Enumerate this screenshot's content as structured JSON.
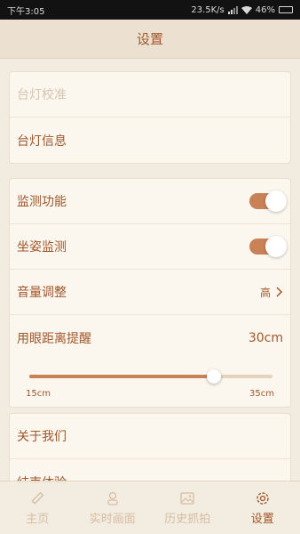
{
  "status_bar": {
    "time": "下午3:05",
    "network_speed": "23.5K/s",
    "battery": "46%"
  },
  "header": {
    "title": "设置"
  },
  "group1": {
    "items": [
      {
        "label": "台灯校准",
        "disabled": true
      },
      {
        "label": "台灯信息",
        "disabled": false
      }
    ]
  },
  "group2": {
    "monitor": {
      "label": "监测功能",
      "enabled": true
    },
    "posture": {
      "label": "坐姿监测",
      "enabled": true
    },
    "volume": {
      "label": "音量调整",
      "value": "高"
    },
    "distance": {
      "label": "用眼距离提醒",
      "value": "30cm",
      "slider_min": "15cm",
      "slider_max": "35cm",
      "slider_fraction": 0.76
    }
  },
  "group3": {
    "about": {
      "label": "关于我们"
    },
    "end": {
      "label": "结束体验"
    }
  },
  "nav": {
    "home": "主页",
    "live": "实时画面",
    "history": "历史抓拍",
    "settings": "设置"
  },
  "colors": {
    "accent": "#a0572c",
    "toggle_on": "#c98156",
    "background": "#f2ebe0",
    "card": "#fbf6ee",
    "inactive_nav": "#d6bda3"
  },
  "icons": {
    "home": "ruler-icon",
    "live": "person-icon",
    "history": "image-icon",
    "settings": "gear-icon"
  }
}
